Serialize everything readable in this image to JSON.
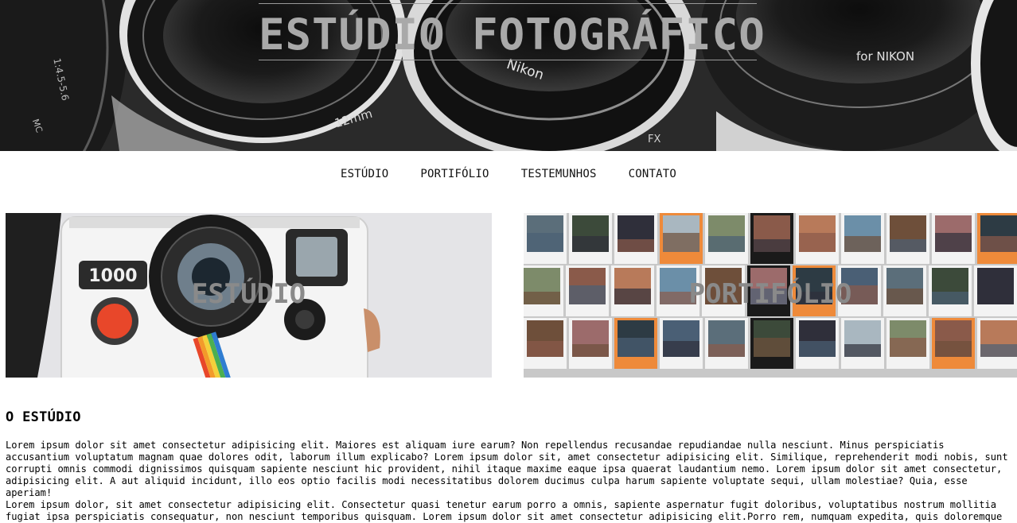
{
  "hero": {
    "title": "ESTÚDIO FOTOGRÁFICO",
    "lens_texts": [
      "Nikon",
      "12mm",
      "for NIKON",
      "FX",
      "1:4.5-5.6",
      "MC"
    ]
  },
  "nav": {
    "items": [
      {
        "label": "ESTÚDIO"
      },
      {
        "label": "PORTIFÓLIO"
      },
      {
        "label": "TESTEMUNHOS"
      },
      {
        "label": "CONTATO"
      }
    ]
  },
  "cards": {
    "studio": {
      "label": "ESTÚDIO",
      "camera_counter": "1000"
    },
    "portfolio": {
      "label": "PORTIFÓLIO"
    }
  },
  "about": {
    "title": "O ESTÚDIO",
    "paragraphs": [
      "Lorem ipsum dolor sit amet consectetur adipisicing elit. Maiores est aliquam iure earum? Non repellendus recusandae repudiandae nulla nesciunt. Minus perspiciatis accusantium voluptatum magnam quae dolores odit, laborum illum explicabo? Lorem ipsum dolor sit, amet consectetur adipisicing elit. Similique, reprehenderit modi nobis, sunt corrupti omnis commodi dignissimos quisquam sapiente nesciunt hic provident, nihil itaque maxime eaque ipsa quaerat laudantium nemo. Lorem ipsum dolor sit amet consectetur, adipisicing elit. A aut aliquid incidunt, illo eos optio facilis modi necessitatibus dolorem ducimus culpa harum sapiente voluptate sequi, ullam molestiae? Quia, esse aperiam!",
      "Lorem ipsum dolor, sit amet consectetur adipisicing elit. Consectetur quasi tenetur earum porro a omnis, sapiente aspernatur fugit doloribus, voluptatibus nostrum mollitia fugiat ipsa perspiciatis consequatur, non nesciunt temporibus quisquam. Lorem ipsum dolor sit amet consectetur adipisicing elit.Porro rem, numquam expedita, quis doloremque"
    ]
  }
}
